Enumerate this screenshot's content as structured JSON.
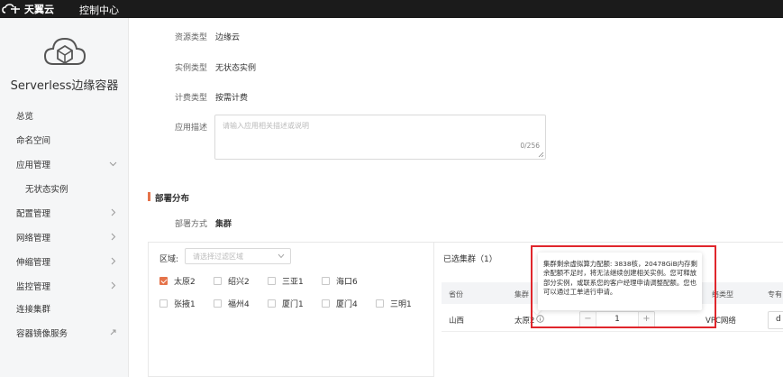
{
  "header": {
    "brand": "天翼云",
    "console": "控制中心"
  },
  "sidebar": {
    "product_title": "Serverless边缘容器",
    "items": [
      {
        "label": "总览",
        "arrow": false
      },
      {
        "label": "命名空间",
        "arrow": false
      },
      {
        "label": "应用管理",
        "arrow": "down"
      },
      {
        "label": "无状态实例",
        "arrow": false,
        "sub": true
      },
      {
        "label": "配置管理",
        "arrow": "right"
      },
      {
        "label": "网络管理",
        "arrow": "right"
      },
      {
        "label": "伸缩管理",
        "arrow": "right"
      },
      {
        "label": "监控管理",
        "arrow": "right"
      },
      {
        "label": "连接集群",
        "arrow": false
      },
      {
        "label": "容器镜像服务",
        "arrow": "link"
      }
    ]
  },
  "form": {
    "resource_type_label": "资源类型",
    "resource_type_value": "边缘云",
    "instance_type_label": "实例类型",
    "instance_type_value": "无状态实例",
    "billing_type_label": "计费类型",
    "billing_type_value": "按需计费",
    "description_label": "应用描述",
    "description_placeholder": "请输入应用相关描述或说明",
    "description_counter": "0/256"
  },
  "deploy": {
    "section_title": "部署分布",
    "mode_label": "部署方式",
    "mode_value": "集群",
    "region_label": "区域:",
    "region_placeholder": "请选择过滤区域",
    "regions": [
      {
        "label": "太原2",
        "checked": true
      },
      {
        "label": "绍兴2",
        "checked": false
      },
      {
        "label": "三亚1",
        "checked": false
      },
      {
        "label": "海口6",
        "checked": false
      },
      {
        "label": "张掖1",
        "checked": false
      },
      {
        "label": "福州4",
        "checked": false
      },
      {
        "label": "厦门1",
        "checked": false
      },
      {
        "label": "厦门4",
        "checked": false
      },
      {
        "label": "三明1",
        "checked": false
      }
    ]
  },
  "selected": {
    "title": "已选集群（1）",
    "columns": [
      "省份",
      "集群",
      "络类型",
      "专有"
    ],
    "row": {
      "province": "山西",
      "cluster": "太原2",
      "count": "1",
      "network": "VPC网络",
      "dedicated": "d"
    }
  },
  "stepper": {
    "minus": "−",
    "plus": "+"
  },
  "tooltip": {
    "text": "集群剩余虚拟算力配额: 3838核，20478GiB内存剩余配额不足时，将无法继续创建相关实例。您可释放部分实例，或联系您的客户经理申请调整配额。您也可以通过工单进行申请。"
  },
  "colors": {
    "accent": "#e5734a",
    "highlight": "#e0262c",
    "topbar": "#1b1b1b"
  }
}
